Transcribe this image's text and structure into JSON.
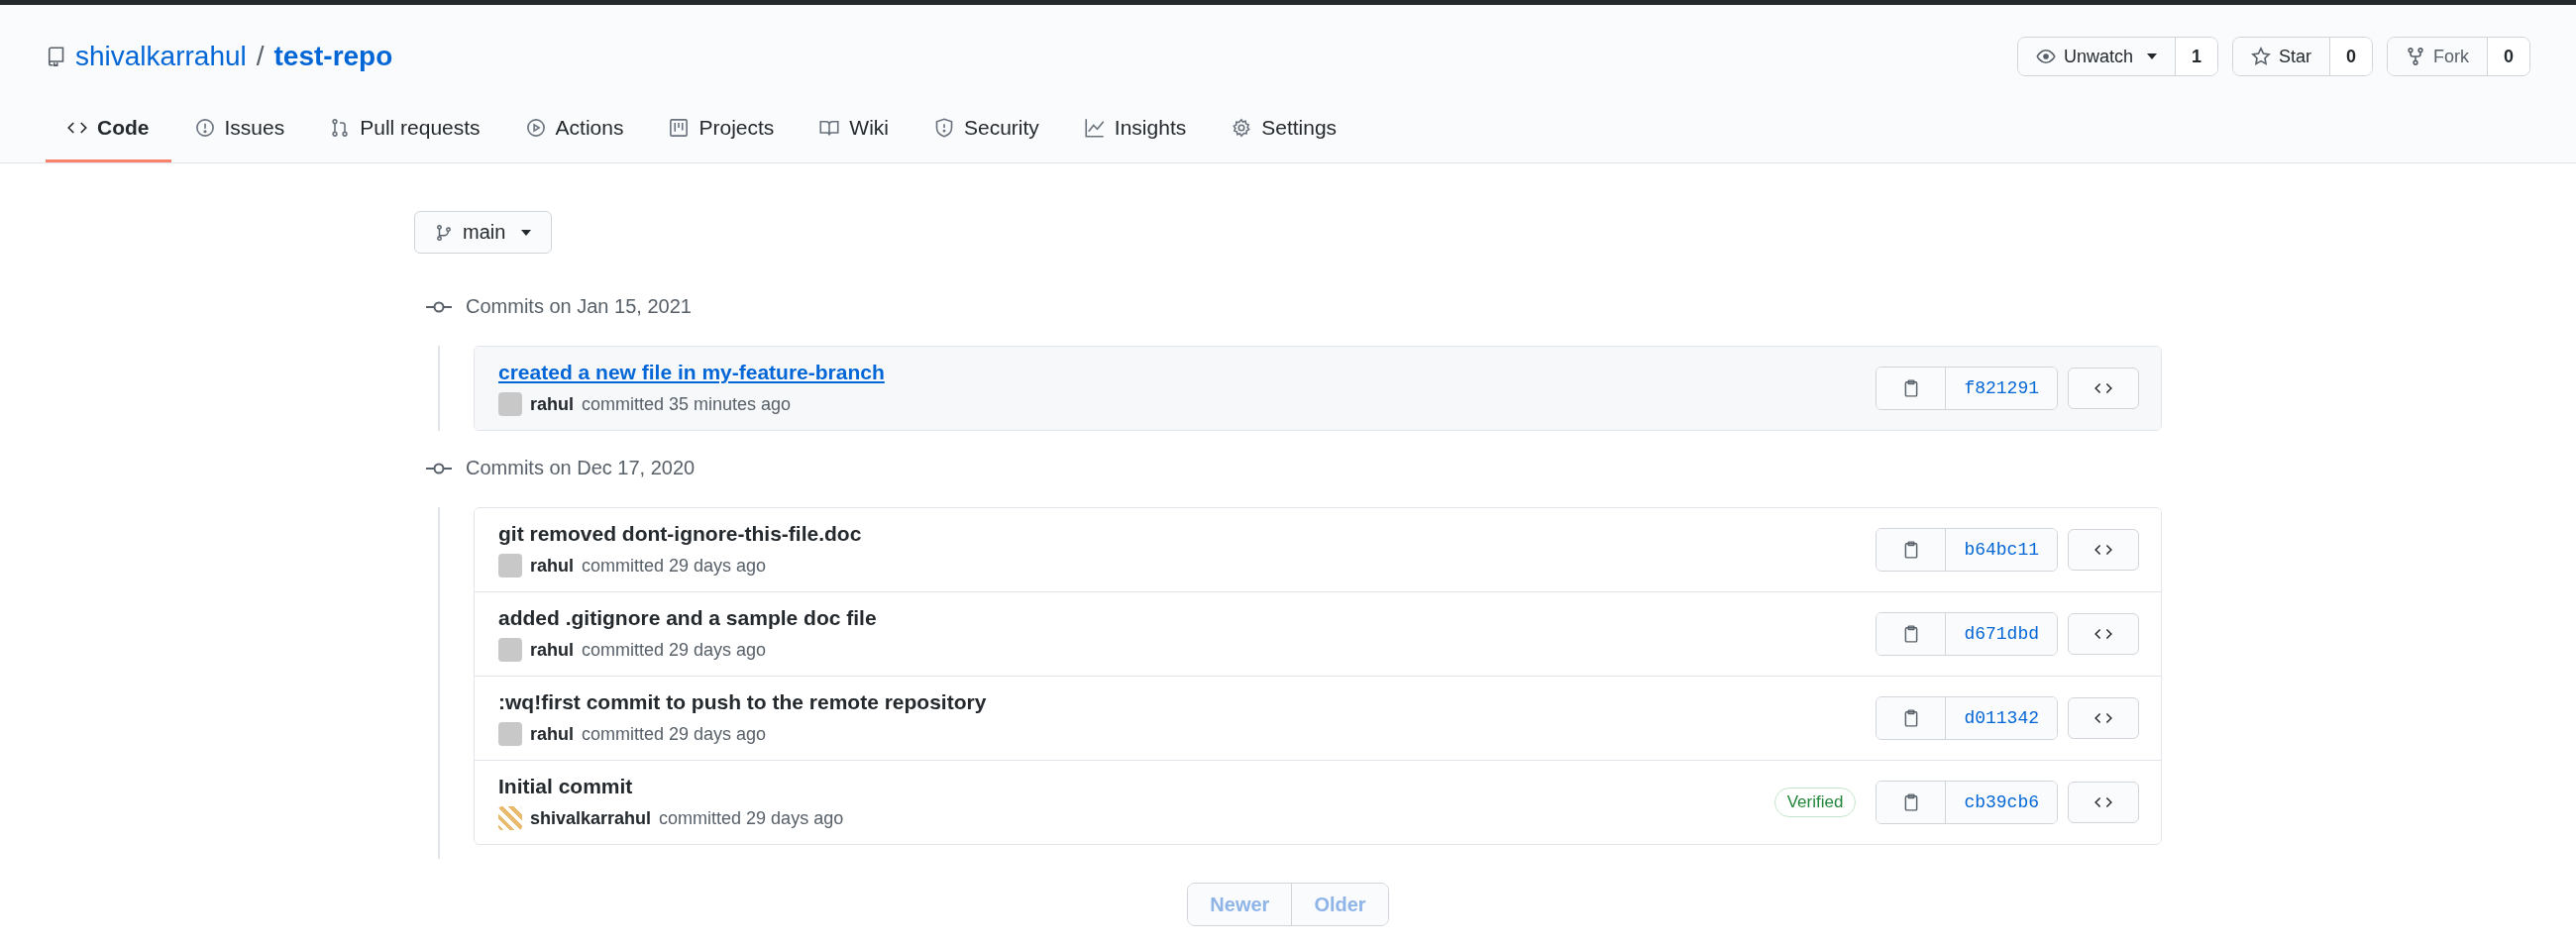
{
  "repo": {
    "owner": "shivalkarrahul",
    "separator": "/",
    "name": "test-repo"
  },
  "repo_actions": [
    {
      "kind": "watch",
      "label": "Unwatch",
      "count": "1"
    },
    {
      "kind": "star",
      "label": "Star",
      "count": "0"
    },
    {
      "kind": "fork",
      "label": "Fork",
      "count": "0"
    }
  ],
  "tabs": [
    {
      "label": "Code",
      "kind": "code",
      "selected": true
    },
    {
      "label": "Issues",
      "kind": "issue",
      "selected": false
    },
    {
      "label": "Pull requests",
      "kind": "pr",
      "selected": false
    },
    {
      "label": "Actions",
      "kind": "play",
      "selected": false
    },
    {
      "label": "Projects",
      "kind": "project",
      "selected": false
    },
    {
      "label": "Wiki",
      "kind": "book",
      "selected": false
    },
    {
      "label": "Security",
      "kind": "shield",
      "selected": false
    },
    {
      "label": "Insights",
      "kind": "graph",
      "selected": false
    },
    {
      "label": "Settings",
      "kind": "gear",
      "selected": false
    }
  ],
  "branch": "main",
  "commit_groups": [
    {
      "heading": "Commits on Jan 15, 2021",
      "commits": [
        {
          "title": "created a new file in my-feature-branch",
          "author": "rahul",
          "meta": "committed 35 minutes ago",
          "sha": "f821291",
          "highlighted": true,
          "kind": "default"
        }
      ]
    },
    {
      "heading": "Commits on Dec 17, 2020",
      "commits": [
        {
          "title": "git removed dont-ignore-this-file.doc",
          "author": "rahul",
          "meta": "committed 29 days ago",
          "sha": "b64bc11",
          "highlighted": false,
          "kind": "default"
        },
        {
          "title": "added .gitignore and a sample doc file",
          "author": "rahul",
          "meta": "committed 29 days ago",
          "sha": "d671dbd",
          "highlighted": false,
          "kind": "default"
        },
        {
          "title": ":wq!first commit to push to the remote repository",
          "author": "rahul",
          "meta": "committed 29 days ago",
          "sha": "d011342",
          "highlighted": false,
          "kind": "default"
        },
        {
          "title": "Initial commit",
          "author": "shivalkarrahul",
          "meta": "committed 29 days ago",
          "sha": "cb39cb6",
          "highlighted": false,
          "kind": "identicon",
          "badge": "Verified"
        }
      ]
    }
  ],
  "pagination": [
    {
      "label": "Newer",
      "disabled": true
    },
    {
      "label": "Older",
      "disabled": true
    }
  ]
}
